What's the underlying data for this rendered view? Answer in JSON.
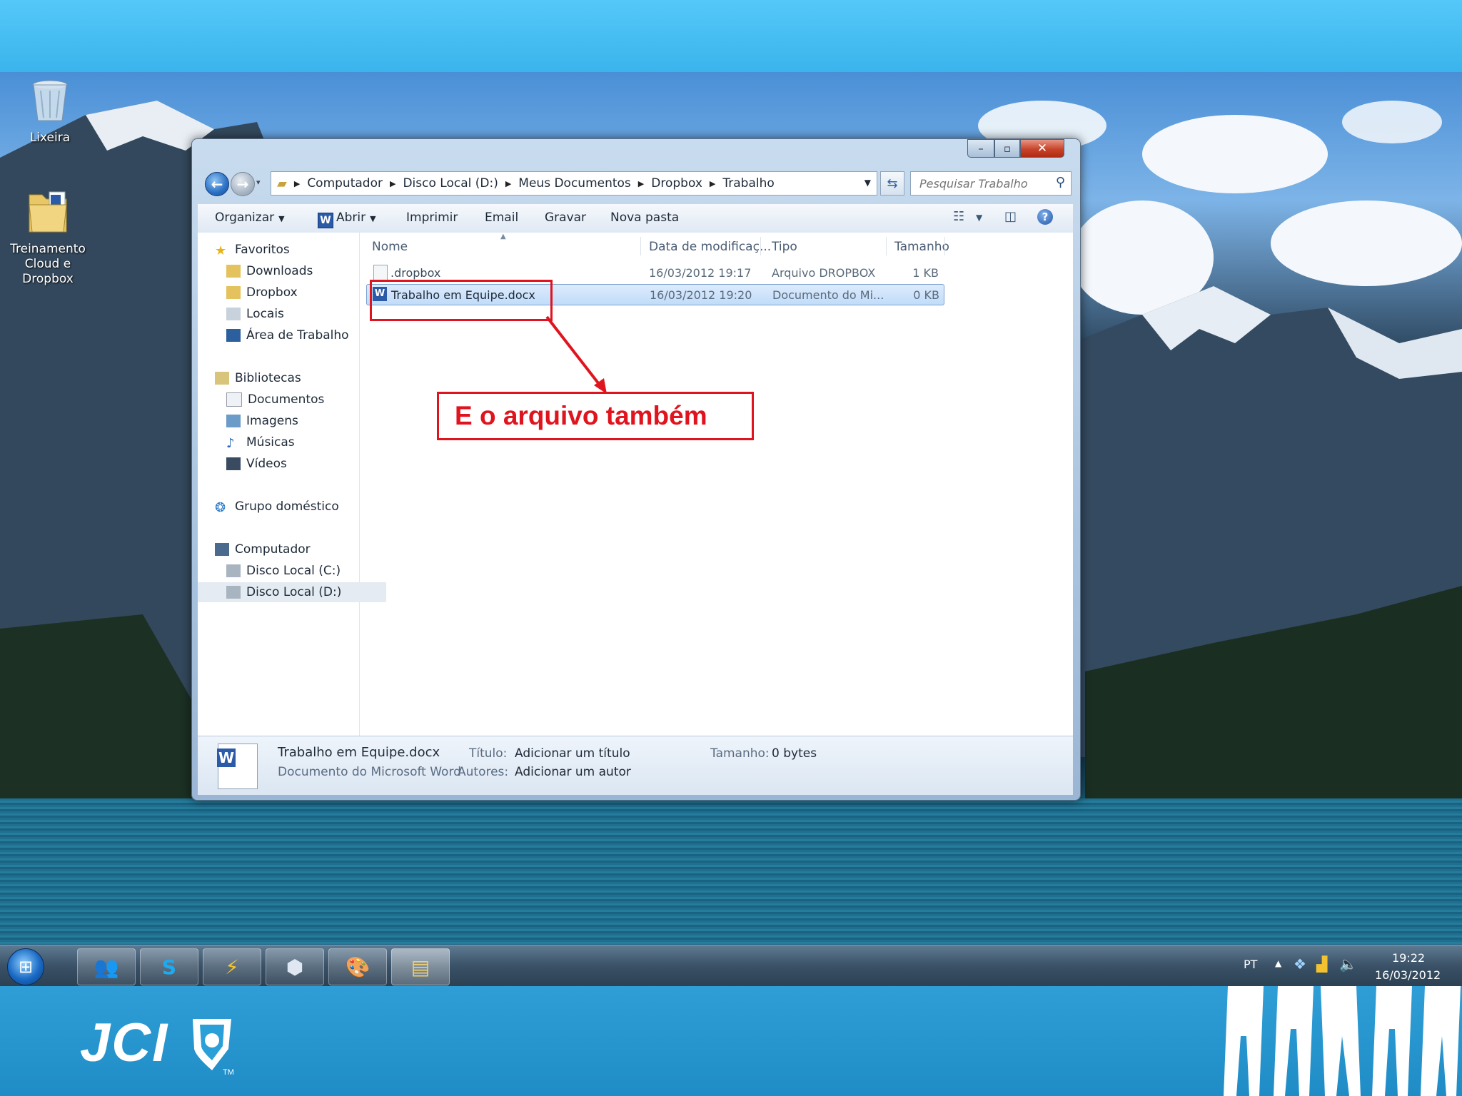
{
  "desktop": {
    "icons": [
      {
        "label": "Lixeira",
        "icon": "recycle-bin-icon"
      },
      {
        "label_line1": "Treinamento",
        "label_line2": "Cloud e Dropbox",
        "icon": "folder-icon"
      }
    ]
  },
  "window": {
    "controls": {
      "minimize": "–",
      "maximize": "▫",
      "close": "✕"
    },
    "breadcrumb": [
      "Computador",
      "Disco Local (D:)",
      "Meus Documentos",
      "Dropbox",
      "Trabalho"
    ],
    "search_placeholder": "Pesquisar Trabalho",
    "toolbar": {
      "organize": "Organizar",
      "open": "Abrir",
      "print": "Imprimir",
      "email": "Email",
      "burn": "Gravar",
      "new_folder": "Nova pasta"
    },
    "nav_pane": {
      "favorites": {
        "label": "Favoritos",
        "items": [
          "Downloads",
          "Dropbox",
          "Locais",
          "Área de Trabalho"
        ]
      },
      "libraries": {
        "label": "Bibliotecas",
        "items": [
          "Documentos",
          "Imagens",
          "Músicas",
          "Vídeos"
        ]
      },
      "homegroup": {
        "label": "Grupo doméstico"
      },
      "computer": {
        "label": "Computador",
        "items": [
          "Disco Local (C:)",
          "Disco Local (D:)"
        ]
      }
    },
    "columns": {
      "name": "Nome",
      "date": "Data de modificaç...",
      "type": "Tipo",
      "size": "Tamanho"
    },
    "files": [
      {
        "name": ".dropbox",
        "date": "16/03/2012 19:17",
        "type": "Arquivo DROPBOX",
        "size": "1 KB"
      },
      {
        "name": "Trabalho em Equipe.docx",
        "date": "16/03/2012 19:20",
        "type": "Documento do Mi...",
        "size": "0 KB",
        "selected": true
      }
    ],
    "details": {
      "file_name": "Trabalho em Equipe.docx",
      "file_kind": "Documento do Microsoft Word",
      "title_label": "Título:",
      "title_value": "Adicionar um título",
      "authors_label": "Autores:",
      "authors_value": "Adicionar um autor",
      "size_label": "Tamanho:",
      "size_value": "0 bytes"
    }
  },
  "annotation": {
    "text": "E o arquivo também",
    "color": "#e0141e"
  },
  "taskbar": {
    "language": "PT",
    "time": "19:22",
    "date": "16/03/2012"
  },
  "branding": {
    "logo_text": "JCI",
    "trademark": "TM"
  }
}
